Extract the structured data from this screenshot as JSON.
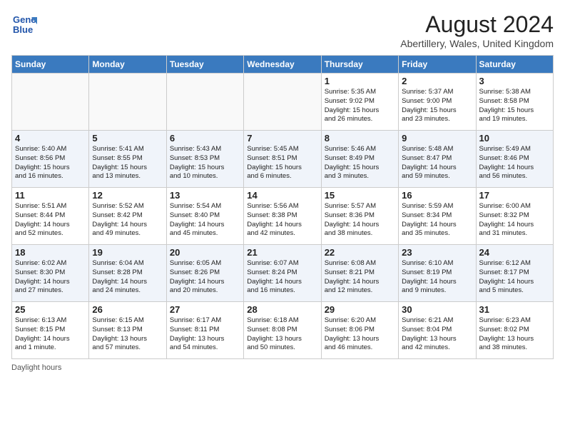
{
  "header": {
    "logo_line1": "General",
    "logo_line2": "Blue",
    "month_year": "August 2024",
    "location": "Abertillery, Wales, United Kingdom"
  },
  "weekdays": [
    "Sunday",
    "Monday",
    "Tuesday",
    "Wednesday",
    "Thursday",
    "Friday",
    "Saturday"
  ],
  "weeks": [
    [
      {
        "day": "",
        "info": ""
      },
      {
        "day": "",
        "info": ""
      },
      {
        "day": "",
        "info": ""
      },
      {
        "day": "",
        "info": ""
      },
      {
        "day": "1",
        "info": "Sunrise: 5:35 AM\nSunset: 9:02 PM\nDaylight: 15 hours\nand 26 minutes."
      },
      {
        "day": "2",
        "info": "Sunrise: 5:37 AM\nSunset: 9:00 PM\nDaylight: 15 hours\nand 23 minutes."
      },
      {
        "day": "3",
        "info": "Sunrise: 5:38 AM\nSunset: 8:58 PM\nDaylight: 15 hours\nand 19 minutes."
      }
    ],
    [
      {
        "day": "4",
        "info": "Sunrise: 5:40 AM\nSunset: 8:56 PM\nDaylight: 15 hours\nand 16 minutes."
      },
      {
        "day": "5",
        "info": "Sunrise: 5:41 AM\nSunset: 8:55 PM\nDaylight: 15 hours\nand 13 minutes."
      },
      {
        "day": "6",
        "info": "Sunrise: 5:43 AM\nSunset: 8:53 PM\nDaylight: 15 hours\nand 10 minutes."
      },
      {
        "day": "7",
        "info": "Sunrise: 5:45 AM\nSunset: 8:51 PM\nDaylight: 15 hours\nand 6 minutes."
      },
      {
        "day": "8",
        "info": "Sunrise: 5:46 AM\nSunset: 8:49 PM\nDaylight: 15 hours\nand 3 minutes."
      },
      {
        "day": "9",
        "info": "Sunrise: 5:48 AM\nSunset: 8:47 PM\nDaylight: 14 hours\nand 59 minutes."
      },
      {
        "day": "10",
        "info": "Sunrise: 5:49 AM\nSunset: 8:46 PM\nDaylight: 14 hours\nand 56 minutes."
      }
    ],
    [
      {
        "day": "11",
        "info": "Sunrise: 5:51 AM\nSunset: 8:44 PM\nDaylight: 14 hours\nand 52 minutes."
      },
      {
        "day": "12",
        "info": "Sunrise: 5:52 AM\nSunset: 8:42 PM\nDaylight: 14 hours\nand 49 minutes."
      },
      {
        "day": "13",
        "info": "Sunrise: 5:54 AM\nSunset: 8:40 PM\nDaylight: 14 hours\nand 45 minutes."
      },
      {
        "day": "14",
        "info": "Sunrise: 5:56 AM\nSunset: 8:38 PM\nDaylight: 14 hours\nand 42 minutes."
      },
      {
        "day": "15",
        "info": "Sunrise: 5:57 AM\nSunset: 8:36 PM\nDaylight: 14 hours\nand 38 minutes."
      },
      {
        "day": "16",
        "info": "Sunrise: 5:59 AM\nSunset: 8:34 PM\nDaylight: 14 hours\nand 35 minutes."
      },
      {
        "day": "17",
        "info": "Sunrise: 6:00 AM\nSunset: 8:32 PM\nDaylight: 14 hours\nand 31 minutes."
      }
    ],
    [
      {
        "day": "18",
        "info": "Sunrise: 6:02 AM\nSunset: 8:30 PM\nDaylight: 14 hours\nand 27 minutes."
      },
      {
        "day": "19",
        "info": "Sunrise: 6:04 AM\nSunset: 8:28 PM\nDaylight: 14 hours\nand 24 minutes."
      },
      {
        "day": "20",
        "info": "Sunrise: 6:05 AM\nSunset: 8:26 PM\nDaylight: 14 hours\nand 20 minutes."
      },
      {
        "day": "21",
        "info": "Sunrise: 6:07 AM\nSunset: 8:24 PM\nDaylight: 14 hours\nand 16 minutes."
      },
      {
        "day": "22",
        "info": "Sunrise: 6:08 AM\nSunset: 8:21 PM\nDaylight: 14 hours\nand 12 minutes."
      },
      {
        "day": "23",
        "info": "Sunrise: 6:10 AM\nSunset: 8:19 PM\nDaylight: 14 hours\nand 9 minutes."
      },
      {
        "day": "24",
        "info": "Sunrise: 6:12 AM\nSunset: 8:17 PM\nDaylight: 14 hours\nand 5 minutes."
      }
    ],
    [
      {
        "day": "25",
        "info": "Sunrise: 6:13 AM\nSunset: 8:15 PM\nDaylight: 14 hours\nand 1 minute."
      },
      {
        "day": "26",
        "info": "Sunrise: 6:15 AM\nSunset: 8:13 PM\nDaylight: 13 hours\nand 57 minutes."
      },
      {
        "day": "27",
        "info": "Sunrise: 6:17 AM\nSunset: 8:11 PM\nDaylight: 13 hours\nand 54 minutes."
      },
      {
        "day": "28",
        "info": "Sunrise: 6:18 AM\nSunset: 8:08 PM\nDaylight: 13 hours\nand 50 minutes."
      },
      {
        "day": "29",
        "info": "Sunrise: 6:20 AM\nSunset: 8:06 PM\nDaylight: 13 hours\nand 46 minutes."
      },
      {
        "day": "30",
        "info": "Sunrise: 6:21 AM\nSunset: 8:04 PM\nDaylight: 13 hours\nand 42 minutes."
      },
      {
        "day": "31",
        "info": "Sunrise: 6:23 AM\nSunset: 8:02 PM\nDaylight: 13 hours\nand 38 minutes."
      }
    ]
  ],
  "footer": "Daylight hours"
}
